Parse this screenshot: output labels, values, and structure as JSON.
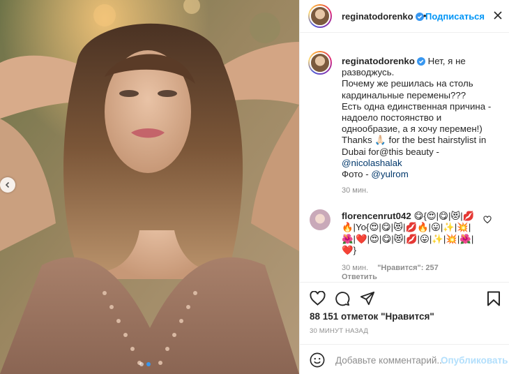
{
  "photo": {
    "carousel_prev_icon": "chevron-left-icon",
    "slide_count": 2,
    "active_slide": 2
  },
  "header": {
    "username": "reginatodorenko",
    "separator": "•",
    "follow_label": "Подписаться",
    "more_icon": "more-options-icon"
  },
  "caption": {
    "username": "reginatodorenko",
    "lines": [
      "Нет, я не разводжусь.",
      "Почему же решилась на столь кардинальные перемены???",
      "Есть одна единственная причина - надоело постоянство и однообразие, а я хочу перемен!)",
      "Thanks 🙏🏻 for the best hairstylist in Dubai for@this beauty -"
    ],
    "mention_stylist": "@nicolashalak",
    "photo_prefix": "Фото - ",
    "mention_photo": "@yulrom",
    "time": "30 мин."
  },
  "comment": {
    "username": "florencenrut042",
    "text": "😋{😍|😋|😻|💋🔥|Yo{😍|😋|😻|💋🔥|😛|✨|💥|🌺|❤️|😍|😋|😻|💋|😛|✨|💥|🌺|❤️}",
    "time": "30 мин.",
    "likes": "\"Нравится\": 257",
    "reply": "Ответить"
  },
  "actions": {
    "likes_text": "88 151 отметок \"Нравится\"",
    "time_ago": "30 МИНУТ НАЗАД",
    "comment_placeholder": "Добавьте комментарий...",
    "publish_label": "Опубликовать"
  },
  "colors": {
    "accent": "#0095f6",
    "publish_disabled": "#b2dffc",
    "muted": "#8e8e8e",
    "text": "#262626"
  }
}
